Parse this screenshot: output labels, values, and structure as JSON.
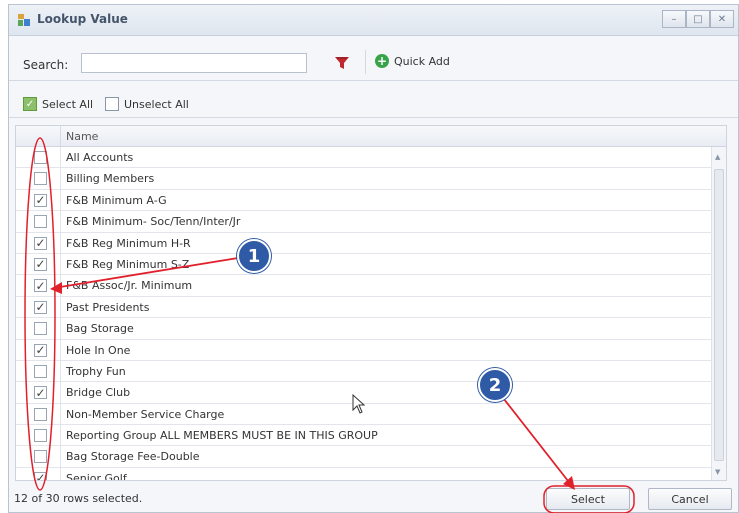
{
  "window": {
    "title": "Lookup Value",
    "controls": [
      "minimize-icon",
      "maximize-icon",
      "close-icon"
    ]
  },
  "toolbar": {
    "search_label": "Search:",
    "search_value": "",
    "filter_icon": "filter-icon",
    "quick_add_label": "Quick Add"
  },
  "selection": {
    "select_all_label": "Select All",
    "unselect_all_label": "Unselect All"
  },
  "grid": {
    "column_header": "Name",
    "rows": [
      {
        "name": "All Accounts",
        "checked": false
      },
      {
        "name": "Billing Members",
        "checked": false
      },
      {
        "name": "F&B  Minimum A-G",
        "checked": true
      },
      {
        "name": "F&B Minimum- Soc/Tenn/Inter/Jr",
        "checked": false
      },
      {
        "name": "F&B Reg Minimum H-R",
        "checked": true
      },
      {
        "name": "F&B Reg Minimum S-Z",
        "checked": true
      },
      {
        "name": "F&B Assoc/Jr. Minimum",
        "checked": true
      },
      {
        "name": "Past Presidents",
        "checked": true
      },
      {
        "name": "Bag Storage",
        "checked": false
      },
      {
        "name": "Hole In One",
        "checked": true
      },
      {
        "name": "Trophy Fun",
        "checked": false
      },
      {
        "name": "Bridge Club",
        "checked": true
      },
      {
        "name": "Non-Member Service Charge",
        "checked": false
      },
      {
        "name": "Reporting Group ALL MEMBERS MUST BE IN THIS GROUP",
        "checked": false
      },
      {
        "name": "Bag Storage Fee-Double",
        "checked": false
      },
      {
        "name": "Senior Golf",
        "checked": true
      }
    ]
  },
  "footer": {
    "status": "12 of 30 rows selected.",
    "select_label": "Select",
    "cancel_label": "Cancel"
  },
  "annotations": {
    "callout_1": "1",
    "callout_2": "2",
    "callout_color": "#2f5aa6",
    "highlight_color": "#e0202a"
  }
}
